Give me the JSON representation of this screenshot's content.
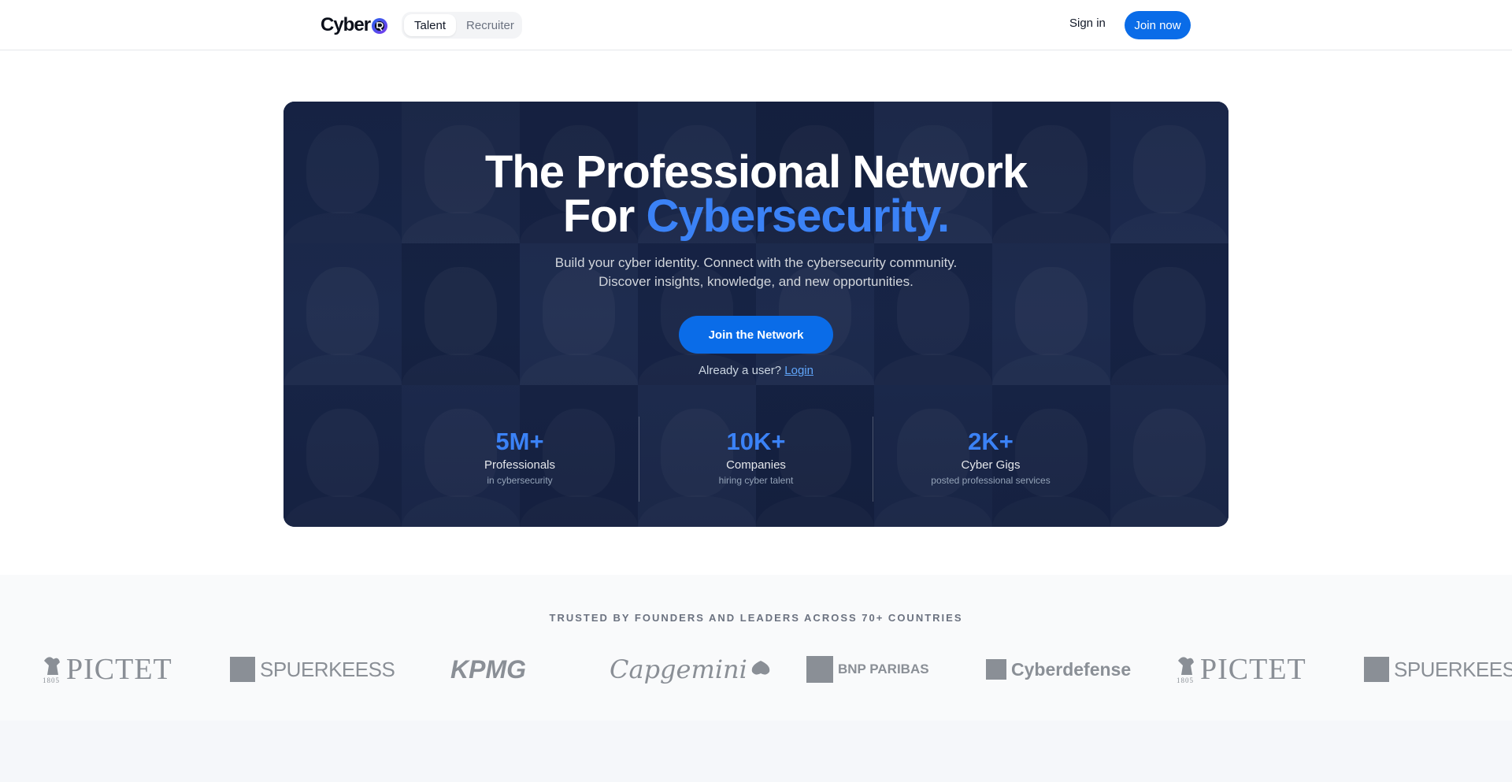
{
  "nav": {
    "logo_text": "Cyber",
    "toggle": [
      "Talent",
      "Recruiter"
    ],
    "signin": "Sign in",
    "join": "Join now"
  },
  "hero": {
    "title_line1": "The Professional Network",
    "title_for": "For",
    "title_accent": "Cybersecurity.",
    "subtitle_line1": "Build your cyber identity. Connect with the cybersecurity community.",
    "subtitle_line2": "Discover insights, knowledge, and new opportunities.",
    "cta": "Join the Network",
    "already": "Already a user?",
    "login": "Login"
  },
  "stats": [
    {
      "value": "5M+",
      "label": "Professionals",
      "sub": "in cybersecurity"
    },
    {
      "value": "10K+",
      "label": "Companies",
      "sub": "hiring cyber talent"
    },
    {
      "value": "2K+",
      "label": "Cyber Gigs",
      "sub": "posted professional services"
    }
  ],
  "trusted": {
    "title": "TRUSTED BY FOUNDERS AND LEADERS ACROSS 70+ COUNTRIES",
    "logos": [
      "PICTET",
      "SPUERKEESS",
      "KPMG",
      "Capgemini",
      "BNP PARIBAS",
      "Cyberdefense",
      "PICTET",
      "SPUERKEESS"
    ],
    "pictet_year": "1805"
  },
  "colors": {
    "accent": "#0a6ce8",
    "accent_text": "#3b82f6",
    "hero_bg": "#0f1b3a"
  }
}
